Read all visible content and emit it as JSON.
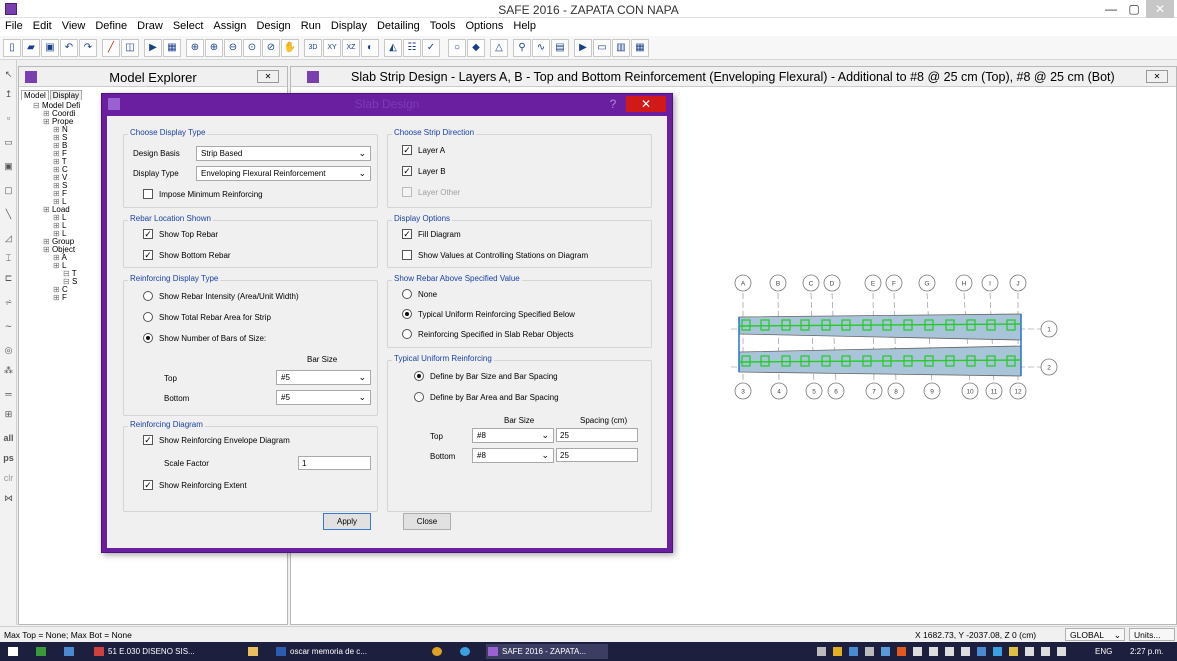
{
  "window": {
    "title": "SAFE 2016 - ZAPATA CON NAPA",
    "controls": [
      "—",
      "▢",
      "✕"
    ]
  },
  "menu": [
    "File",
    "Edit",
    "View",
    "Define",
    "Draw",
    "Select",
    "Assign",
    "Design",
    "Run",
    "Display",
    "Detailing",
    "Tools",
    "Options",
    "Help"
  ],
  "toolbar": {
    "icons": [
      "new-icon",
      "open-icon",
      "save-icon",
      "undo-icon",
      "redo-icon",
      "pencil-icon",
      "frame-icon",
      "play-icon",
      "grid-icon",
      "zoom-window-icon",
      "zoom-in-icon",
      "zoom-out-icon",
      "zoom-fit-icon",
      "zoom-prev-icon",
      "pan-icon",
      "3d-icon",
      "xy-icon",
      "xz-icon",
      "yz-icon",
      "perspective-icon",
      "display-options-icon",
      "check-icon",
      "circle-icon",
      "area-icon",
      "triangle-icon",
      "strip-icon",
      "deformed-icon",
      "table-icon",
      "run-icon",
      "design-icon",
      "detail-icon",
      "grid2-icon"
    ],
    "labels": {
      "three_d": "3D",
      "xy": "XY",
      "xz": "XZ"
    }
  },
  "left_toolbar": {
    "labels": {
      "all": "all",
      "ps": "ps",
      "clr": "clr"
    }
  },
  "explorer": {
    "title": "Model Explorer",
    "tabs": [
      "Model",
      "Display"
    ],
    "tree": [
      {
        "indent": 0,
        "label": "Model Defi"
      },
      {
        "indent": 1,
        "label": "Coordi"
      },
      {
        "indent": 1,
        "label": "Prope"
      },
      {
        "indent": 2,
        "label": "N"
      },
      {
        "indent": 2,
        "label": "S"
      },
      {
        "indent": 2,
        "label": "B"
      },
      {
        "indent": 2,
        "label": "F"
      },
      {
        "indent": 2,
        "label": "T"
      },
      {
        "indent": 2,
        "label": "C"
      },
      {
        "indent": 2,
        "label": "V"
      },
      {
        "indent": 2,
        "label": "S"
      },
      {
        "indent": 2,
        "label": "F"
      },
      {
        "indent": 2,
        "label": "L"
      },
      {
        "indent": 1,
        "label": "Load"
      },
      {
        "indent": 2,
        "label": "L"
      },
      {
        "indent": 2,
        "label": "L"
      },
      {
        "indent": 2,
        "label": "L"
      },
      {
        "indent": 1,
        "label": "Group"
      },
      {
        "indent": 1,
        "label": "Object"
      },
      {
        "indent": 2,
        "label": "A"
      },
      {
        "indent": 2,
        "label": "L"
      },
      {
        "indent": 3,
        "label": "T"
      },
      {
        "indent": 3,
        "label": "S"
      },
      {
        "indent": 2,
        "label": "C"
      },
      {
        "indent": 2,
        "label": "F"
      }
    ]
  },
  "main_view": {
    "title": "Slab Strip Design - Layers A, B - Top and Bottom Reinforcement (Enveloping Flexural)  - Additional to #8 @ 25 cm (Top), #8 @ 25 cm (Bot)",
    "grid_top": [
      "A",
      "B",
      "C",
      "D",
      "E",
      "F",
      "G",
      "H",
      "I",
      "J"
    ],
    "grid_bottom": [
      "3",
      "4",
      "5",
      "6",
      "7",
      "8",
      "9",
      "10",
      "11",
      "12"
    ],
    "grid_right": [
      "1",
      "2"
    ]
  },
  "dialog": {
    "title": "Slab Design",
    "help": "?",
    "close": "✕",
    "display_type": {
      "group": "Choose Display Type",
      "design_basis_label": "Design Basis",
      "design_basis_value": "Strip Based",
      "display_type_label": "Display Type",
      "display_type_value": "Enveloping Flexural Reinforcement",
      "impose_min": "Impose Minimum Reinforcing",
      "impose_min_checked": false
    },
    "rebar_location": {
      "group": "Rebar Location Shown",
      "top": "Show Top Rebar",
      "top_checked": true,
      "bottom": "Show Bottom Rebar",
      "bottom_checked": true
    },
    "reinforcing_display": {
      "group": "Reinforcing Display Type",
      "options": [
        "Show Rebar Intensity (Area/Unit Width)",
        "Show Total Rebar Area for Strip",
        "Show Number of Bars of Size:"
      ],
      "selected": 2,
      "bar_size_header": "Bar Size",
      "top_label": "Top",
      "top_value": "#5",
      "bottom_label": "Bottom",
      "bottom_value": "#5"
    },
    "reinforcing_diagram": {
      "group": "Reinforcing Diagram",
      "envelope": "Show Reinforcing Envelope Diagram",
      "envelope_checked": true,
      "scale_label": "Scale Factor",
      "scale_value": "1",
      "extent": "Show Reinforcing Extent",
      "extent_checked": true
    },
    "strip_direction": {
      "group": "Choose Strip Direction",
      "layer_a": "Layer A",
      "layer_a_checked": true,
      "layer_b": "Layer B",
      "layer_b_checked": true,
      "layer_other": "Layer Other",
      "layer_other_checked": false
    },
    "display_options": {
      "group": "Display Options",
      "fill": "Fill Diagram",
      "fill_checked": true,
      "values": "Show Values at Controlling Stations on Diagram",
      "values_checked": false
    },
    "above_value": {
      "group": "Show Rebar Above Specified Value",
      "options": [
        "None",
        "Typical Uniform Reinforcing Specified Below",
        "Reinforcing Specified in Slab Rebar Objects"
      ],
      "selected": 1
    },
    "typical_uniform": {
      "group": "Typical Uniform Reinforcing",
      "options": [
        "Define by Bar Size and Bar Spacing",
        "Define by Bar Area and Bar Spacing"
      ],
      "selected": 0,
      "bar_size_header": "Bar Size",
      "spacing_header": "Spacing  (cm)",
      "top_label": "Top",
      "top_size": "#8",
      "top_spacing": "25",
      "bottom_label": "Bottom",
      "bottom_size": "#8",
      "bottom_spacing": "25"
    },
    "apply": "Apply",
    "close_button": "Close"
  },
  "status": {
    "left": "Max Top = None;  Max Bot = None",
    "coords": "X 1682.73,  Y -2037.08,  Z 0  (cm)",
    "system": "GLOBAL",
    "units": "Units..."
  },
  "taskbar": {
    "items": [
      {
        "label": "",
        "icon": "windows-icon"
      },
      {
        "label": "",
        "icon": "app-icon"
      },
      {
        "label": "",
        "icon": "explorer-icon"
      },
      {
        "label": "51 E.030 DISENO SIS...",
        "icon": "pdf-icon"
      },
      {
        "label": "",
        "icon": "folder-icon"
      },
      {
        "label": "oscar memoria de c...",
        "icon": "word-icon"
      },
      {
        "label": "",
        "icon": "chrome-icon"
      },
      {
        "label": "",
        "icon": "ie-icon"
      },
      {
        "label": "SAFE 2016 - ZAPATA...",
        "icon": "safe-icon"
      }
    ],
    "lang": "ENG",
    "time": "2:27 p.m."
  },
  "colors": {
    "dialog_frame": "#6a1fa0",
    "group_label": "#1a3fa8",
    "slab_fill": "#a8c4d8",
    "rebar_green": "#22cc22",
    "taskbar": "#1d1f3f"
  }
}
